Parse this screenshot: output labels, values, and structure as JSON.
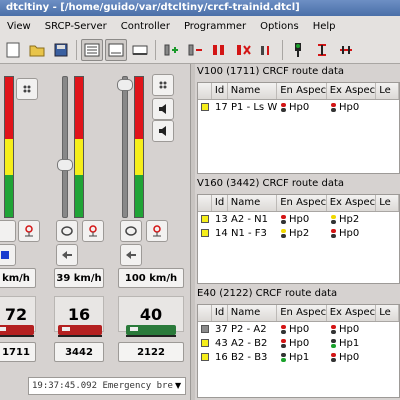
{
  "window": {
    "title": "dtcltiny - [/home/guido/var/dtcltiny/crcf-trainid.dtcl]"
  },
  "menu": [
    "View",
    "SRCP-Server",
    "Controller",
    "Programmer",
    "Options",
    "Help"
  ],
  "toolbar": {
    "icons": [
      "new-icon",
      "open-icon",
      "save-icon",
      "view-1-icon",
      "view-2-icon",
      "view-3-icon",
      "add-loco-icon",
      "remove-loco-icon",
      "power-on-icon",
      "power-off-icon",
      "info-icon",
      "signal-icon",
      "crossing-icon",
      "more-icon"
    ]
  },
  "locos": [
    {
      "speed": "km/h",
      "number": "72",
      "address": "1711",
      "meter": {
        "red": 0.44,
        "yellow": 0.26,
        "green": 0.3
      }
    },
    {
      "speed": "39 km/h",
      "number": "16",
      "address": "3442",
      "meter": {
        "red": 0.44,
        "yellow": 0.26,
        "green": 0.3
      },
      "throttle": 0.36
    },
    {
      "speed": "100 km/h",
      "number": "40",
      "address": "2122",
      "meter": {
        "red": 0.44,
        "yellow": 0.26,
        "green": 0.3
      },
      "throttle": 0.98
    }
  ],
  "status": {
    "message": "19:37:45.092 Emergency bre"
  },
  "colors": {
    "red": "#e0141a",
    "yellow": "#f5ee1a",
    "green": "#20a436",
    "signal_red": "#d31515",
    "signal_yellow": "#f0d800",
    "signal_green": "#1aa12b"
  },
  "tables": [
    {
      "title": "V100 (1711) CRCF route data",
      "headers": [
        "",
        "Id",
        "Name",
        "En Aspect",
        "Ex Aspect",
        "Le"
      ],
      "rows": [
        {
          "color": "#f5ee1a",
          "id": "17",
          "name": "P1 - Ls W 3",
          "en": "Hp0",
          "en_sig": "red",
          "ex": "Hp0",
          "ex_sig": "red"
        }
      ]
    },
    {
      "title": "V160 (3442) CRCF route data",
      "headers": [
        "",
        "Id",
        "Name",
        "En Aspect",
        "Ex Aspect",
        "Le"
      ],
      "rows": [
        {
          "color": "#f5ee1a",
          "id": "13",
          "name": "A2 - N1",
          "en": "Hp0",
          "en_sig": "red",
          "ex": "Hp2",
          "ex_sig": "yellow"
        },
        {
          "color": "#f5ee1a",
          "id": "14",
          "name": "N1 - F3",
          "en": "Hp2",
          "en_sig": "yellow",
          "ex": "Hp0",
          "ex_sig": "red"
        }
      ]
    },
    {
      "title": "E40 (2122) CRCF route data",
      "headers": [
        "",
        "Id",
        "Name",
        "En Aspect",
        "Ex Aspect",
        "Le"
      ],
      "rows": [
        {
          "color": "#8a8a8a",
          "id": "37",
          "name": "P2 - A2",
          "en": "Hp0",
          "en_sig": "red",
          "ex": "Hp0",
          "ex_sig": "red"
        },
        {
          "color": "#f5ee1a",
          "id": "43",
          "name": "A2 - B2",
          "en": "Hp0",
          "en_sig": "red",
          "ex": "Hp1",
          "ex_sig": "green"
        },
        {
          "color": "#f5ee1a",
          "id": "16",
          "name": "B2 - B3",
          "en": "Hp1",
          "en_sig": "green",
          "ex": "Hp0",
          "ex_sig": "red"
        }
      ]
    }
  ]
}
